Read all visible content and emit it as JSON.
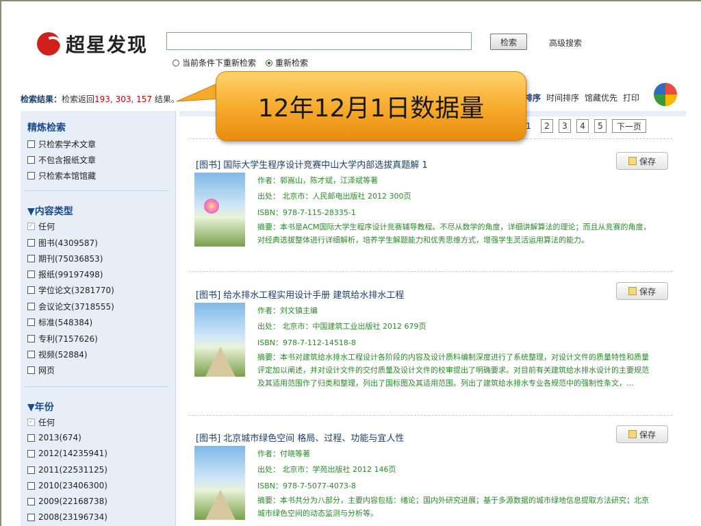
{
  "header": {
    "logo_text": "超星发现",
    "search_placeholder": "",
    "search_button": "检索",
    "advanced_link": "高级搜索",
    "radio_options": [
      "当前条件下重新检索",
      "重新检索"
    ],
    "radio_selected": 1
  },
  "result_bar": {
    "label": "检索结果：",
    "prefix": "检索返回",
    "counts": "193, 303, 157",
    "suffix": "结果。"
  },
  "sort_bar": {
    "relevance": "排序",
    "time_sort": "时间排序",
    "collection_first": "馆藏优先",
    "print": "打印"
  },
  "callout": {
    "text": "12年12月1日数据量"
  },
  "pager": [
    "1",
    "2",
    "3",
    "4",
    "5"
  ],
  "pager_next": "下一页",
  "refine": {
    "title": "精炼检索",
    "options": [
      "只检索学术文章",
      "不包含报纸文章",
      "只检索本馆馆藏"
    ]
  },
  "content_type": {
    "title": "▼内容类型",
    "any": "任何",
    "options": [
      "图书(4309587)",
      "期刊(75036853)",
      "报纸(99197498)",
      "学位论文(3281770)",
      "会议论文(3718555)",
      "标准(548384)",
      "专利(7157626)",
      "视频(52884)",
      "网页"
    ]
  },
  "year": {
    "title": "▼年份",
    "any": "任何",
    "options": [
      "2013(674)",
      "2012(14235941)",
      "2011(22531125)",
      "2010(23406300)",
      "2009(22168738)",
      "2008(23196734)"
    ]
  },
  "results": [
    {
      "title": "[图书] 国际大学生程序设计竞赛中山大学内部选拔真题解 1",
      "author": "作者：郭嵩山，陈才斌，江泽斌等著",
      "source": "出处： 北京市：人民邮电出版社  2012  300页",
      "isbn": "ISBN：978-7-115-28335-1",
      "abstract": "摘要：本书是ACM国际大学生程序设计竞赛辅导教程。不尽从数学的角度，详细讲解算法的理论；而且从竞赛的角度，对经典选拔整体进行详细解析，培养学生解题能力和优秀思维方式，增强学生灵活运用算法的能力。",
      "save": "保存"
    },
    {
      "title": "[图书] 给水排水工程实用设计手册 建筑给水排水工程",
      "author": "作者：刘文镇主编",
      "source": "出处： 北京市：中国建筑工业出版社  2012  679页",
      "isbn": "ISBN：978-7-112-14518-8",
      "abstract": "摘要：本书对建筑给水排水工程设计各阶段的内容及设计质料编制深度进行了系统整理，对设计文件的质量特性和质量评定加以阐述，并对设计文件的交付质量及设计文件的校审提出了明确要求。对目前有关建筑给水排水设计的主要规范及其适用范围作了归类和整理，列出了国标图及其适用范围。列出了建筑给水排水专业各规范中的强制性条文，...",
      "save": "保存"
    },
    {
      "title": "[图书] 北京城市绿色空间 格局、过程、功能与宜人性",
      "author": "作者：付晓等著",
      "source": "出处： 北京市：学苑出版社  2012  146页",
      "isbn": "ISBN：978-7-5077-4073-8",
      "abstract": "摘要：本书共分为八部分，主要内容包括：绪论；国内外研究进展；基于多源数据的城市绿地信息提取方法研究；北京城市绿色空间的动态监测与分析等。",
      "save": "保存"
    }
  ]
}
